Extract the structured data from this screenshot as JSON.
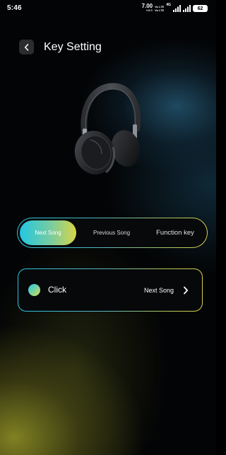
{
  "status_bar": {
    "time": "5:46",
    "net_speed": "7.00",
    "net_speed_unit": "KB/S",
    "volte_top": "Vo LTE",
    "volte_bottom": "Vo LTE",
    "network_type": "4G",
    "battery": "62"
  },
  "header": {
    "title": "Key Setting"
  },
  "tabs": [
    {
      "label": "Next Song",
      "selected": true
    },
    {
      "label": "Previous Song",
      "selected": false
    },
    {
      "label": "Function key",
      "selected": false
    }
  ],
  "action": {
    "label": "Click",
    "value": "Next Song"
  },
  "icons": {
    "back": "chevron-left-icon",
    "action_arrow": "chevron-right-icon",
    "product": "headphones-image"
  },
  "colors": {
    "accent_cyan": "#21c7e3",
    "accent_yellow": "#d7d548",
    "background": "#030405"
  }
}
